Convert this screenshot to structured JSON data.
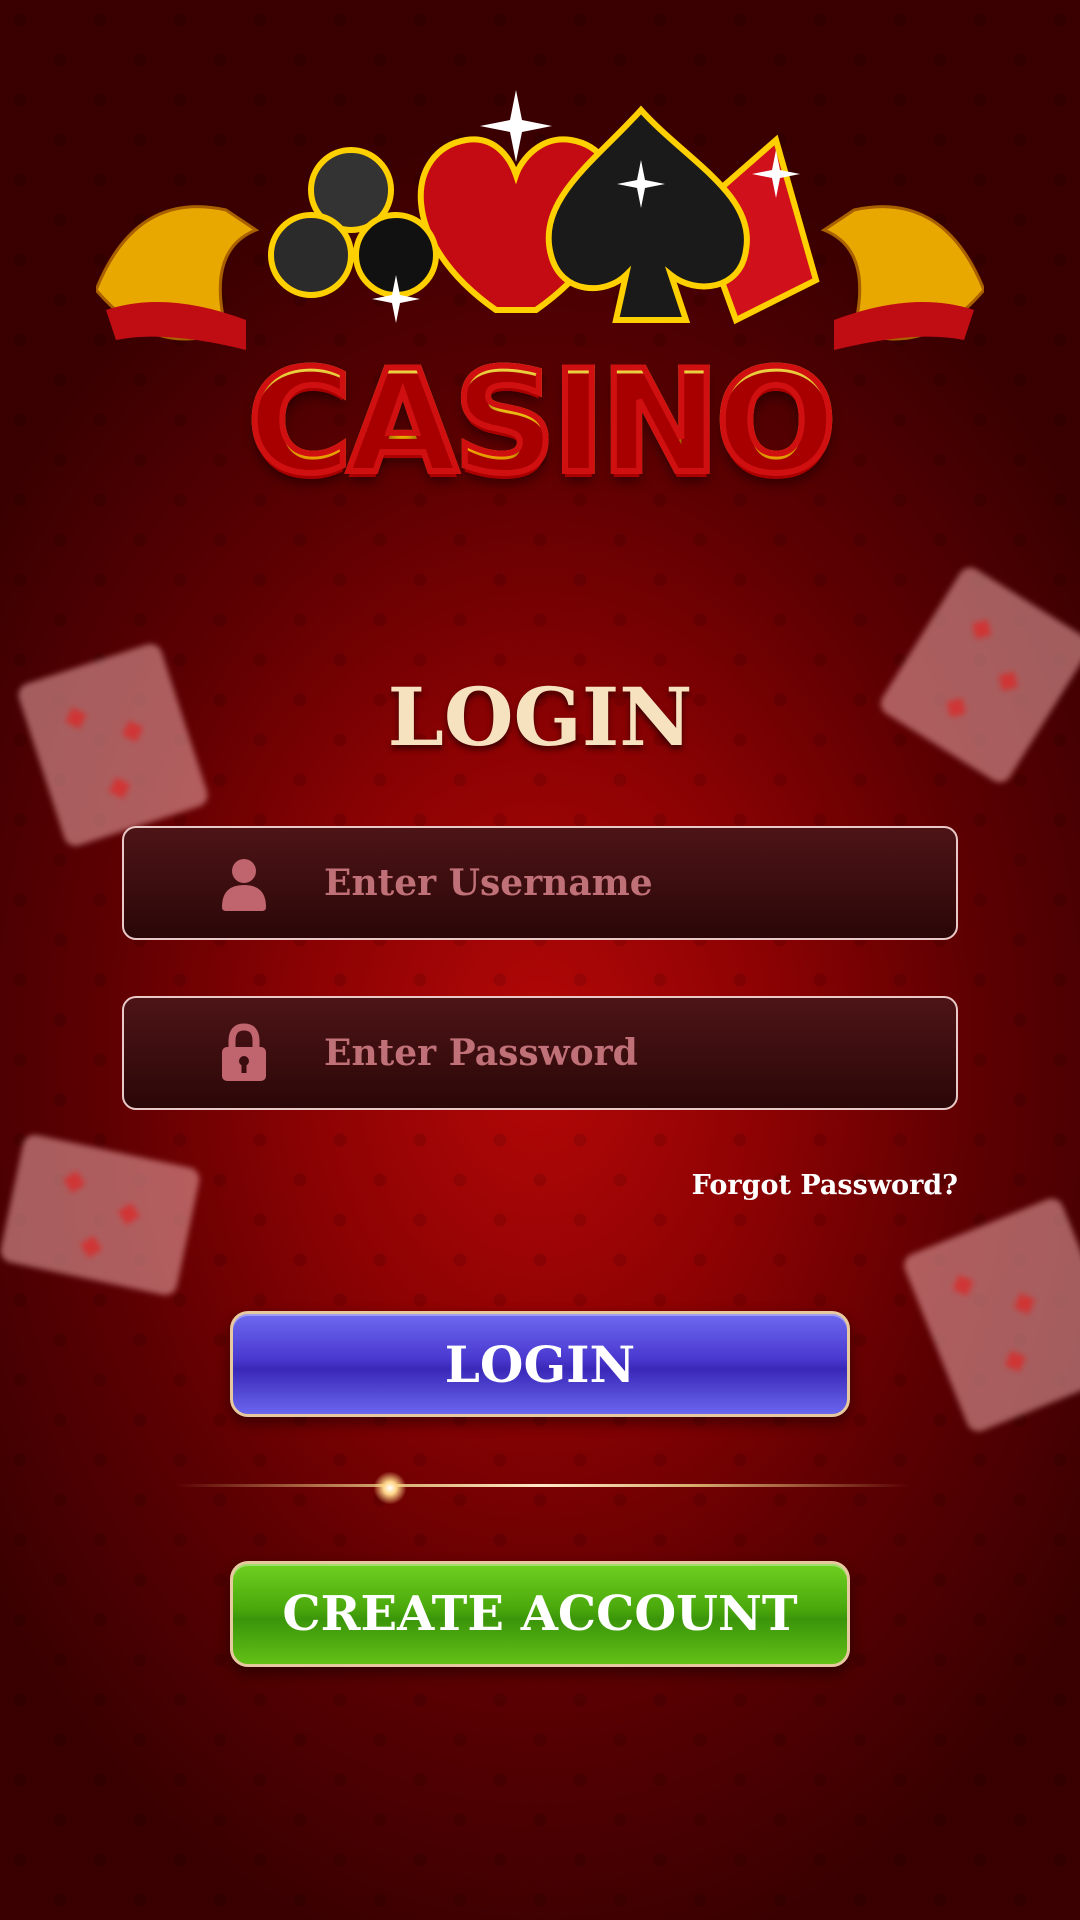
{
  "logo": {
    "text": "CASINO"
  },
  "heading": "LOGIN",
  "username": {
    "placeholder": "Enter Username"
  },
  "password": {
    "placeholder": "Enter Password"
  },
  "forgot_password": "Forgot Password?",
  "login_button": "LOGIN",
  "create_account_button": "CREATE ACCOUNT",
  "colors": {
    "background": "#8c0203",
    "login_button": "#4a38cf",
    "create_button": "#4aa80c",
    "heading": "#f6e2bf"
  },
  "icons": [
    "user-icon",
    "lock-icon"
  ]
}
